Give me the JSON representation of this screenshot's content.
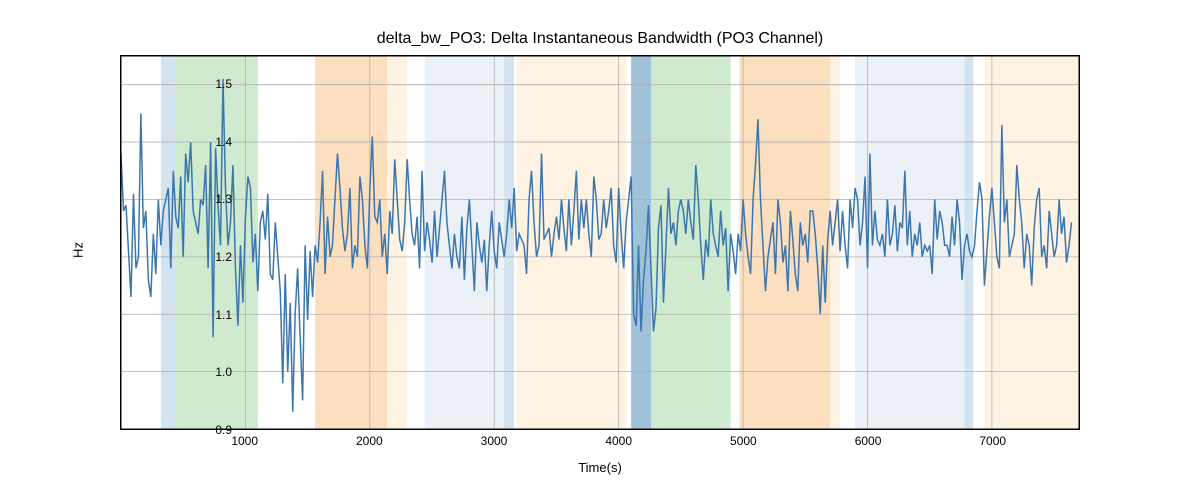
{
  "chart_data": {
    "type": "line",
    "title": "delta_bw_PO3: Delta Instantaneous Bandwidth (PO3 Channel)",
    "xlabel": "Time(s)",
    "ylabel": "Hz",
    "xlim": [
      0,
      7700
    ],
    "ylim": [
      0.9,
      1.55
    ],
    "xticks": [
      1000,
      2000,
      3000,
      4000,
      5000,
      6000,
      7000
    ],
    "yticks": [
      0.9,
      1.0,
      1.1,
      1.2,
      1.3,
      1.4,
      1.5
    ],
    "spans": [
      {
        "x0": 320,
        "x1": 440,
        "color": "#a8c8e0",
        "alpha": 0.5
      },
      {
        "x0": 440,
        "x1": 1100,
        "color": "#a0d6a0",
        "alpha": 0.5
      },
      {
        "x0": 1560,
        "x1": 2140,
        "color": "#f8c080",
        "alpha": 0.5
      },
      {
        "x0": 2140,
        "x1": 2300,
        "color": "#fde8c8",
        "alpha": 0.5
      },
      {
        "x0": 2440,
        "x1": 3080,
        "color": "#d8e4ee",
        "alpha": 0.5
      },
      {
        "x0": 3080,
        "x1": 3160,
        "color": "#a8c8e0",
        "alpha": 0.5
      },
      {
        "x0": 3180,
        "x1": 4060,
        "color": "#fde8c8",
        "alpha": 0.5
      },
      {
        "x0": 4100,
        "x1": 4260,
        "color": "#508fb8",
        "alpha": 0.55
      },
      {
        "x0": 4260,
        "x1": 4900,
        "color": "#a0d6a0",
        "alpha": 0.5
      },
      {
        "x0": 4970,
        "x1": 5700,
        "color": "#f8c080",
        "alpha": 0.5
      },
      {
        "x0": 5700,
        "x1": 5780,
        "color": "#fde8c8",
        "alpha": 0.5
      },
      {
        "x0": 5900,
        "x1": 6780,
        "color": "#d8e4ee",
        "alpha": 0.5
      },
      {
        "x0": 6780,
        "x1": 6850,
        "color": "#a8c8e0",
        "alpha": 0.5
      },
      {
        "x0": 6940,
        "x1": 7700,
        "color": "#fde8c8",
        "alpha": 0.5
      }
    ],
    "series": [
      {
        "name": "delta_bw_PO3",
        "color": "#3c76af",
        "x": [
          0,
          20,
          40,
          60,
          80,
          100,
          120,
          140,
          160,
          180,
          200,
          220,
          240,
          260,
          280,
          300,
          320,
          340,
          360,
          380,
          400,
          420,
          440,
          460,
          480,
          500,
          520,
          540,
          560,
          580,
          600,
          620,
          640,
          660,
          680,
          700,
          720,
          740,
          760,
          780,
          800,
          820,
          840,
          860,
          880,
          900,
          920,
          940,
          960,
          980,
          1000,
          1020,
          1040,
          1060,
          1080,
          1100,
          1120,
          1140,
          1160,
          1180,
          1200,
          1220,
          1240,
          1260,
          1280,
          1300,
          1320,
          1340,
          1360,
          1380,
          1400,
          1420,
          1440,
          1460,
          1480,
          1500,
          1520,
          1540,
          1560,
          1580,
          1600,
          1620,
          1640,
          1660,
          1680,
          1700,
          1720,
          1740,
          1760,
          1780,
          1800,
          1820,
          1840,
          1860,
          1880,
          1900,
          1920,
          1940,
          1960,
          1980,
          2000,
          2020,
          2040,
          2060,
          2080,
          2100,
          2120,
          2140,
          2160,
          2180,
          2200,
          2220,
          2240,
          2260,
          2280,
          2300,
          2320,
          2340,
          2360,
          2380,
          2400,
          2420,
          2440,
          2460,
          2480,
          2500,
          2520,
          2540,
          2560,
          2580,
          2600,
          2620,
          2640,
          2660,
          2680,
          2700,
          2720,
          2740,
          2760,
          2780,
          2800,
          2820,
          2840,
          2860,
          2880,
          2900,
          2920,
          2940,
          2960,
          2980,
          3000,
          3020,
          3040,
          3060,
          3080,
          3100,
          3120,
          3140,
          3160,
          3180,
          3200,
          3220,
          3240,
          3260,
          3280,
          3300,
          3320,
          3340,
          3360,
          3380,
          3400,
          3420,
          3440,
          3460,
          3480,
          3500,
          3520,
          3540,
          3560,
          3580,
          3600,
          3620,
          3640,
          3660,
          3680,
          3700,
          3720,
          3740,
          3760,
          3780,
          3800,
          3820,
          3840,
          3860,
          3880,
          3900,
          3920,
          3940,
          3960,
          3980,
          4000,
          4020,
          4040,
          4060,
          4080,
          4100,
          4120,
          4140,
          4160,
          4180,
          4200,
          4220,
          4240,
          4260,
          4280,
          4300,
          4320,
          4340,
          4360,
          4380,
          4400,
          4420,
          4440,
          4460,
          4480,
          4500,
          4520,
          4540,
          4560,
          4580,
          4600,
          4620,
          4640,
          4660,
          4680,
          4700,
          4720,
          4740,
          4760,
          4780,
          4800,
          4820,
          4840,
          4860,
          4880,
          4900,
          4920,
          4940,
          4960,
          4980,
          5000,
          5020,
          5040,
          5060,
          5080,
          5100,
          5120,
          5140,
          5160,
          5180,
          5200,
          5220,
          5240,
          5260,
          5280,
          5300,
          5320,
          5340,
          5360,
          5380,
          5400,
          5420,
          5440,
          5460,
          5480,
          5500,
          5520,
          5540,
          5560,
          5580,
          5600,
          5620,
          5640,
          5660,
          5680,
          5700,
          5720,
          5740,
          5760,
          5780,
          5800,
          5820,
          5840,
          5860,
          5880,
          5900,
          5920,
          5940,
          5960,
          5980,
          6000,
          6020,
          6040,
          6060,
          6080,
          6100,
          6120,
          6140,
          6160,
          6180,
          6200,
          6220,
          6240,
          6260,
          6280,
          6300,
          6320,
          6340,
          6360,
          6380,
          6400,
          6420,
          6440,
          6460,
          6480,
          6500,
          6520,
          6540,
          6560,
          6580,
          6600,
          6620,
          6640,
          6660,
          6680,
          6700,
          6720,
          6740,
          6760,
          6780,
          6800,
          6820,
          6840,
          6860,
          6880,
          6900,
          6920,
          6940,
          6960,
          6980,
          7000,
          7020,
          7040,
          7060,
          7080,
          7100,
          7120,
          7140,
          7160,
          7180,
          7200,
          7220,
          7240,
          7260,
          7280,
          7300,
          7320,
          7340,
          7360,
          7380,
          7400,
          7420,
          7440,
          7460,
          7480,
          7500,
          7520,
          7540,
          7560,
          7580,
          7600,
          7620,
          7640
        ],
        "y": [
          1.38,
          1.28,
          1.29,
          1.21,
          1.13,
          1.31,
          1.18,
          1.2,
          1.45,
          1.25,
          1.28,
          1.16,
          1.13,
          1.24,
          1.17,
          1.3,
          1.22,
          1.28,
          1.3,
          1.32,
          1.18,
          1.35,
          1.27,
          1.25,
          1.34,
          1.2,
          1.38,
          1.33,
          1.4,
          1.28,
          1.26,
          1.24,
          1.3,
          1.29,
          1.36,
          1.18,
          1.4,
          1.06,
          1.39,
          1.29,
          1.22,
          1.51,
          1.32,
          1.22,
          1.26,
          1.36,
          1.18,
          1.08,
          1.22,
          1.12,
          1.27,
          1.34,
          1.32,
          1.19,
          1.24,
          1.14,
          1.26,
          1.28,
          1.23,
          1.31,
          1.17,
          1.16,
          1.26,
          1.2,
          1.14,
          0.98,
          1.17,
          1.0,
          1.12,
          0.93,
          1.1,
          1.18,
          1.06,
          0.95,
          1.22,
          1.09,
          1.21,
          1.13,
          1.22,
          1.19,
          1.26,
          1.35,
          1.17,
          1.27,
          1.2,
          1.22,
          1.3,
          1.38,
          1.32,
          1.25,
          1.21,
          1.24,
          1.32,
          1.18,
          1.22,
          1.2,
          1.34,
          1.3,
          1.22,
          1.18,
          1.32,
          1.41,
          1.27,
          1.26,
          1.3,
          1.2,
          1.24,
          1.17,
          1.28,
          1.24,
          1.37,
          1.3,
          1.23,
          1.21,
          1.26,
          1.37,
          1.3,
          1.24,
          1.22,
          1.27,
          1.18,
          1.35,
          1.21,
          1.26,
          1.23,
          1.19,
          1.28,
          1.2,
          1.25,
          1.3,
          1.35,
          1.26,
          1.22,
          1.18,
          1.24,
          1.2,
          1.18,
          1.27,
          1.16,
          1.25,
          1.3,
          1.22,
          1.14,
          1.26,
          1.22,
          1.19,
          1.23,
          1.14,
          1.22,
          1.28,
          1.21,
          1.18,
          1.26,
          1.23,
          1.2,
          1.24,
          1.3,
          1.25,
          1.32,
          1.21,
          1.24,
          1.23,
          1.22,
          1.17,
          1.3,
          1.35,
          1.26,
          1.2,
          1.22,
          1.38,
          1.23,
          1.24,
          1.25,
          1.2,
          1.24,
          1.27,
          1.23,
          1.3,
          1.25,
          1.21,
          1.3,
          1.22,
          1.28,
          1.35,
          1.23,
          1.3,
          1.25,
          1.3,
          1.24,
          1.2,
          1.34,
          1.3,
          1.23,
          1.24,
          1.3,
          1.25,
          1.28,
          1.32,
          1.22,
          1.19,
          1.32,
          1.24,
          1.18,
          1.26,
          1.3,
          1.34,
          1.1,
          1.08,
          1.22,
          1.07,
          1.16,
          1.21,
          1.29,
          1.18,
          1.07,
          1.11,
          1.25,
          1.29,
          1.12,
          1.22,
          1.32,
          1.24,
          1.26,
          1.22,
          1.28,
          1.3,
          1.28,
          1.24,
          1.3,
          1.26,
          1.23,
          1.36,
          1.3,
          1.22,
          1.16,
          1.23,
          1.2,
          1.3,
          1.24,
          1.22,
          1.2,
          1.28,
          1.22,
          1.25,
          1.14,
          1.24,
          1.21,
          1.17,
          1.24,
          1.21,
          1.3,
          1.24,
          1.2,
          1.17,
          1.3,
          1.36,
          1.44,
          1.3,
          1.22,
          1.14,
          1.2,
          1.23,
          1.26,
          1.17,
          1.3,
          1.26,
          1.19,
          1.22,
          1.14,
          1.28,
          1.23,
          1.17,
          1.14,
          1.26,
          1.22,
          1.24,
          1.19,
          1.28,
          1.28,
          1.24,
          1.18,
          1.1,
          1.22,
          1.12,
          1.23,
          1.28,
          1.22,
          1.26,
          1.3,
          1.21,
          1.28,
          1.22,
          1.18,
          1.3,
          1.25,
          1.32,
          1.3,
          1.22,
          1.26,
          1.34,
          1.18,
          1.38,
          1.22,
          1.28,
          1.23,
          1.22,
          1.24,
          1.2,
          1.3,
          1.22,
          1.24,
          1.29,
          1.21,
          1.26,
          1.25,
          1.35,
          1.22,
          1.28,
          1.2,
          1.24,
          1.22,
          1.26,
          1.2,
          1.22,
          1.21,
          1.22,
          1.17,
          1.3,
          1.23,
          1.28,
          1.26,
          1.22,
          1.22,
          1.2,
          1.27,
          1.22,
          1.3,
          1.26,
          1.16,
          1.22,
          1.24,
          1.21,
          1.2,
          1.22,
          1.28,
          1.33,
          1.3,
          1.15,
          1.21,
          1.27,
          1.32,
          1.26,
          1.2,
          1.18,
          1.43,
          1.26,
          1.3,
          1.2,
          1.22,
          1.24,
          1.36,
          1.3,
          1.26,
          1.18,
          1.24,
          1.22,
          1.15,
          1.25,
          1.3,
          1.32,
          1.2,
          1.22,
          1.18,
          1.28,
          1.24,
          1.2,
          1.22,
          1.3,
          1.24,
          1.27,
          1.19,
          1.22,
          1.26
        ]
      }
    ]
  }
}
